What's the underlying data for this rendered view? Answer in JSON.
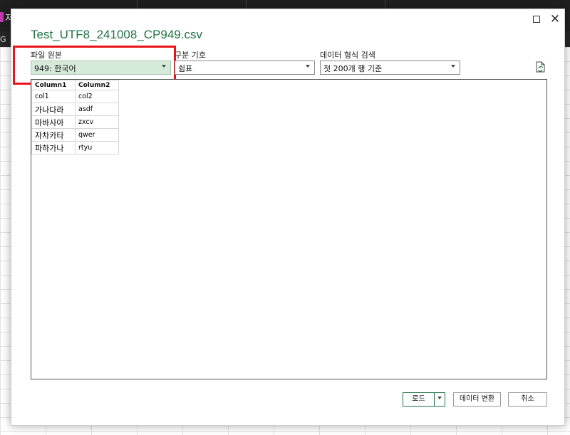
{
  "background": {
    "tab_label": "저",
    "row3_label": "G"
  },
  "dialog": {
    "title": "Test_UTF8_241008_CP949.csv",
    "file_origin": {
      "label": "파일 원본",
      "value": "949: 한국어"
    },
    "delimiter": {
      "label": "구분 기호",
      "value": "쉼표"
    },
    "data_type_detection": {
      "label": "데이터 형식 검색",
      "value": "첫 200개 행 기준"
    },
    "preview": {
      "columns": [
        "Column1",
        "Column2"
      ],
      "rows": [
        [
          "col1",
          "col2"
        ],
        [
          "가나다라",
          "asdf"
        ],
        [
          "마바사아",
          "zxcv"
        ],
        [
          "자차카타",
          "qwer"
        ],
        [
          "파하가나",
          "rtyu"
        ]
      ]
    },
    "buttons": {
      "load": "로드",
      "transform": "데이터 변환",
      "cancel": "취소"
    },
    "icons": {
      "maximize": "maximize-icon",
      "close": "close-icon",
      "refresh": "refresh-document-icon"
    },
    "colors": {
      "title": "#217346",
      "highlight": "#e8141a",
      "selected_dropdown": "#d5ead9"
    }
  }
}
